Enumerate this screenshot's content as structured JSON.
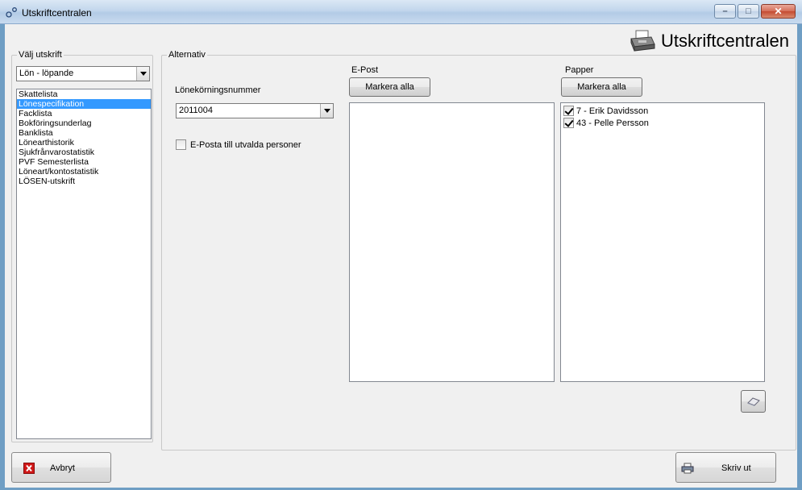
{
  "window": {
    "title": "Utskriftcentralen"
  },
  "header": {
    "title": "Utskriftcentralen",
    "icon": "printer-icon"
  },
  "valj": {
    "legend": "Välj utskrift",
    "selected_category": "Lön - löpande",
    "items": [
      "Skattelista",
      "Lönespecifikation",
      "Facklista",
      "Bokföringsunderlag",
      "Banklista",
      "Lönearthistorik",
      "Sjukfrånvarostatistik",
      "PVF Semesterlista",
      "Löneart/kontostatistik",
      "LÖSEN-utskrift"
    ],
    "selected_index": 1
  },
  "alternativ": {
    "legend": "Alternativ",
    "run_number_label": "Lönekörningsnummer",
    "run_number_value": "2011004",
    "email_checkbox_label": "E-Posta till utvalda personer",
    "email_checked": false,
    "epost": {
      "label": "E-Post",
      "select_all_label": "Markera alla",
      "items": []
    },
    "papper": {
      "label": "Papper",
      "select_all_label": "Markera alla",
      "items": [
        {
          "label": "7 - Erik Davidsson",
          "checked": true
        },
        {
          "label": "43 - Pelle Persson",
          "checked": true
        }
      ]
    }
  },
  "footer": {
    "cancel_label": "Avbryt",
    "print_label": "Skriv ut"
  },
  "colors": {
    "selection": "#3399ff",
    "window_bg": "#f0f0f0",
    "cancel_icon": "#d01818"
  }
}
